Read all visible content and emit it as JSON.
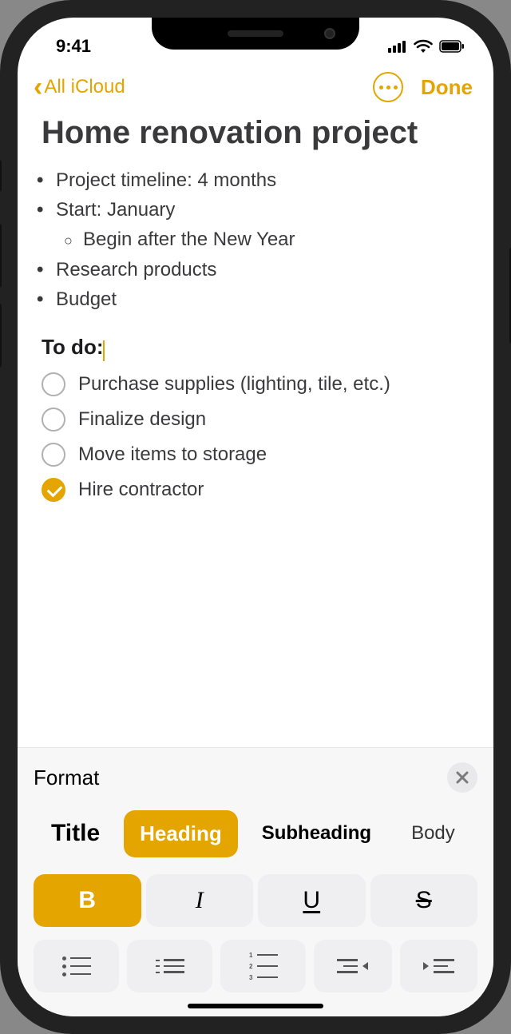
{
  "statusbar": {
    "time": "9:41"
  },
  "nav": {
    "back_label": "All iCloud",
    "done_label": "Done"
  },
  "note": {
    "title": "Home renovation project",
    "bullets": [
      "Project timeline: 4 months",
      "Start: January",
      "Research products",
      "Budget"
    ],
    "sub_bullet": "Begin after the New Year",
    "heading": "To do:",
    "checklist": [
      {
        "text": "Purchase supplies (lighting, tile, etc.)",
        "checked": false
      },
      {
        "text": "Finalize design",
        "checked": false
      },
      {
        "text": "Move items to storage",
        "checked": false
      },
      {
        "text": "Hire contractor",
        "checked": true
      }
    ]
  },
  "format": {
    "panel_title": "Format",
    "styles": {
      "title": "Title",
      "heading": "Heading",
      "subheading": "Subheading",
      "body": "Body",
      "selected": "heading"
    },
    "buis": {
      "bold": "B",
      "italic": "I",
      "underline": "U",
      "strike": "S",
      "active": "bold"
    }
  },
  "colors": {
    "accent": "#e5a500"
  }
}
